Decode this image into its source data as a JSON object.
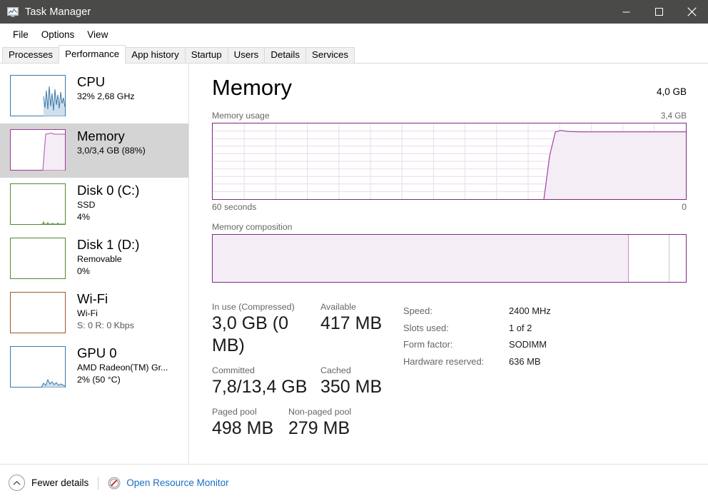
{
  "window": {
    "title": "Task Manager",
    "icon": "task-manager-icon",
    "controls": {
      "minimize": "minimize-icon",
      "maximize": "maximize-icon",
      "close": "close-icon"
    }
  },
  "menu": {
    "items": [
      "File",
      "Options",
      "View"
    ]
  },
  "tabs": {
    "items": [
      "Processes",
      "Performance",
      "App history",
      "Startup",
      "Users",
      "Details",
      "Services"
    ],
    "active": "Performance"
  },
  "sidebar": {
    "items": [
      {
        "title": "CPU",
        "sub1": "32%  2,68 GHz",
        "sub2": "",
        "color": "#3b78a7",
        "selected": false
      },
      {
        "title": "Memory",
        "sub1": "3,0/3,4 GB (88%)",
        "sub2": "",
        "color": "#9b36a0",
        "selected": true
      },
      {
        "title": "Disk 0 (C:)",
        "sub1": "SSD",
        "sub2": "4%",
        "color": "#4f8a2f",
        "selected": false
      },
      {
        "title": "Disk 1 (D:)",
        "sub1": "Removable",
        "sub2": "0%",
        "color": "#4f8a2f",
        "selected": false
      },
      {
        "title": "Wi-Fi",
        "sub1": "Wi-Fi",
        "sub2": "S: 0 R: 0 Kbps",
        "color": "#a2562a",
        "selected": false
      },
      {
        "title": "GPU 0",
        "sub1": "AMD Radeon(TM) Gr...",
        "sub2": "2%  (50 °C)",
        "color": "#3b78a7",
        "selected": false
      }
    ]
  },
  "main": {
    "title": "Memory",
    "capacity": "4,0 GB",
    "usage_label": "Memory usage",
    "usage_max": "3,4 GB",
    "axis_left": "60 seconds",
    "axis_right": "0",
    "composition_label": "Memory composition",
    "accent": "#7a2a80",
    "fill": "#f5edf5",
    "line": "#a64fae"
  },
  "chart_data": {
    "type": "area",
    "title": "Memory usage",
    "xlabel": "60 seconds",
    "ylabel": "",
    "ylim": [
      0,
      3.4
    ],
    "yunit": "GB",
    "xlim": [
      60,
      0
    ],
    "grid": true,
    "x": [
      0,
      5,
      10,
      15,
      20,
      25,
      30,
      35,
      40,
      45,
      50,
      55,
      60,
      62,
      64,
      66,
      67,
      68,
      69,
      70,
      72,
      75,
      80,
      85,
      90,
      95,
      100
    ],
    "values": [
      0,
      0,
      0,
      0,
      0,
      0,
      0,
      0,
      0,
      0,
      0,
      0,
      0,
      0,
      0,
      0,
      0.55,
      1.7,
      2.75,
      3.05,
      2.98,
      3.0,
      3.0,
      3.0,
      3.0,
      3.0,
      3.0
    ],
    "series": [
      {
        "name": "Memory usage",
        "values": [
          0,
          0,
          0,
          0,
          0,
          0,
          0,
          0,
          0,
          0,
          0,
          0,
          0,
          0,
          0,
          0,
          0.55,
          1.7,
          2.75,
          3.05,
          2.98,
          3.0,
          3.0,
          3.0,
          3.0,
          3.0,
          3.0
        ]
      }
    ],
    "composition": [
      {
        "name": "in-use",
        "percent": 88.0
      },
      {
        "name": "modified",
        "percent": 8.6
      },
      {
        "name": "free",
        "percent": 3.4
      }
    ]
  },
  "stats": {
    "left": [
      [
        {
          "label": "In use (Compressed)",
          "value": "3,0 GB (0 MB)",
          "w": 152
        },
        {
          "label": "Available",
          "value": "417 MB",
          "w": 110
        }
      ],
      [
        {
          "label": "Committed",
          "value": "7,8/13,4 GB",
          "w": 152
        },
        {
          "label": "Cached",
          "value": "350 MB",
          "w": 110
        }
      ],
      [
        {
          "label": "Paged pool",
          "value": "498 MB",
          "w": 107
        },
        {
          "label": "Non-paged pool",
          "value": "279 MB",
          "w": 110
        }
      ]
    ],
    "right": [
      {
        "label": "Speed:",
        "value": "2400 MHz"
      },
      {
        "label": "Slots used:",
        "value": "1 of 2"
      },
      {
        "label": "Form factor:",
        "value": "SODIMM"
      },
      {
        "label": "Hardware reserved:",
        "value": "636 MB"
      }
    ]
  },
  "footer": {
    "fewer_details": "Fewer details",
    "fewer_icon": "chevron-up-icon",
    "resource_monitor": "Open Resource Monitor",
    "resource_icon": "resource-monitor-icon"
  }
}
